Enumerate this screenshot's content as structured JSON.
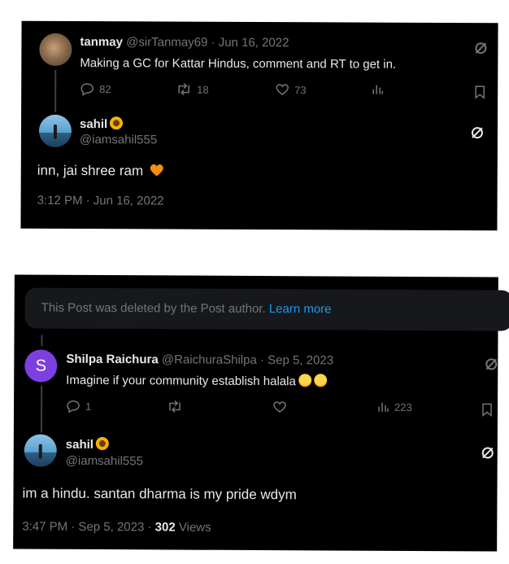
{
  "panel1": {
    "parent": {
      "display_name": "tanmay",
      "handle_date": "@sirTanmay69 · Jun 16, 2022",
      "text": "Making a GC for Kattar Hindus, comment and RT to get in.",
      "replies": "82",
      "retweets": "18",
      "likes": "73"
    },
    "reply": {
      "display_name": "sahil",
      "handle": "@iamsahil555",
      "text": "inn, jai shree ram",
      "timestamp": "3:12 PM · Jun 16, 2022"
    }
  },
  "panel2": {
    "deleted": {
      "message": "This Post was deleted by the Post author.",
      "link": "Learn more"
    },
    "parent": {
      "avatar_letter": "S",
      "display_name": "Shilpa Raichura",
      "handle_date": "@RaichuraShilpa · Sep 5, 2023",
      "text": "Imagine if your community establish halala",
      "replies": "1",
      "views": "223"
    },
    "reply": {
      "display_name": "sahil",
      "handle": "@iamsahil555",
      "text": "im a hindu. santan dharma is my pride wdym",
      "timestamp": "3:47 PM · Sep 5, 2023 ·",
      "views_count": "302",
      "views_label": "Views"
    }
  },
  "colors": {
    "background": "#000000",
    "text": "#e7e9ea",
    "muted": "#71767b",
    "link": "#1d9bf0",
    "avatar_s": "#7e3fe0"
  }
}
